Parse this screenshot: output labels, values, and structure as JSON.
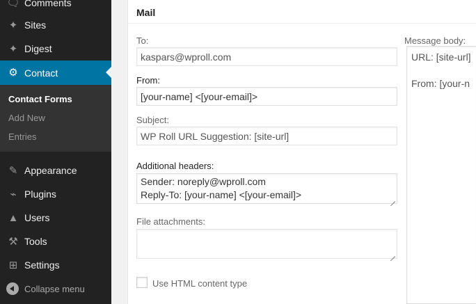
{
  "sidebar": {
    "items": [
      {
        "label": "Comments",
        "icon": "comment-icon"
      },
      {
        "label": "Sites",
        "icon": "pushpin-icon"
      },
      {
        "label": "Digest",
        "icon": "pushpin-icon"
      },
      {
        "label": "Contact",
        "icon": "gear-icon",
        "current": true
      },
      {
        "label": "Appearance",
        "icon": "paintbrush-icon"
      },
      {
        "label": "Plugins",
        "icon": "plug-icon"
      },
      {
        "label": "Users",
        "icon": "user-icon"
      },
      {
        "label": "Tools",
        "icon": "wrench-icon"
      },
      {
        "label": "Settings",
        "icon": "settings-icon"
      }
    ],
    "submenu": [
      {
        "label": "Contact Forms",
        "current": true
      },
      {
        "label": "Add New"
      },
      {
        "label": "Entries"
      }
    ],
    "collapse_label": "Collapse menu"
  },
  "mail": {
    "title": "Mail",
    "to": {
      "label": "To:",
      "value": "kaspars@wproll.com"
    },
    "from": {
      "label": "From:",
      "value": "[your-name] <[your-email]>"
    },
    "subject": {
      "label": "Subject:",
      "value": "WP Roll URL Suggestion: [site-url]"
    },
    "headers": {
      "label": "Additional headers:",
      "value": "Sender: noreply@wproll.com\nReply-To: [your-name] <[your-email]>"
    },
    "attachments": {
      "label": "File attachments:",
      "value": ""
    },
    "html_content": {
      "label": "Use HTML content type",
      "checked": false
    },
    "message_body": {
      "label": "Message body:",
      "lines": [
        "URL: [site-url]",
        "From: [your-n"
      ]
    }
  },
  "colors": {
    "sidebar_bg": "#222222",
    "submenu_bg": "#333333",
    "accent": "#0074a2",
    "page_bg": "#f1f1f1"
  }
}
